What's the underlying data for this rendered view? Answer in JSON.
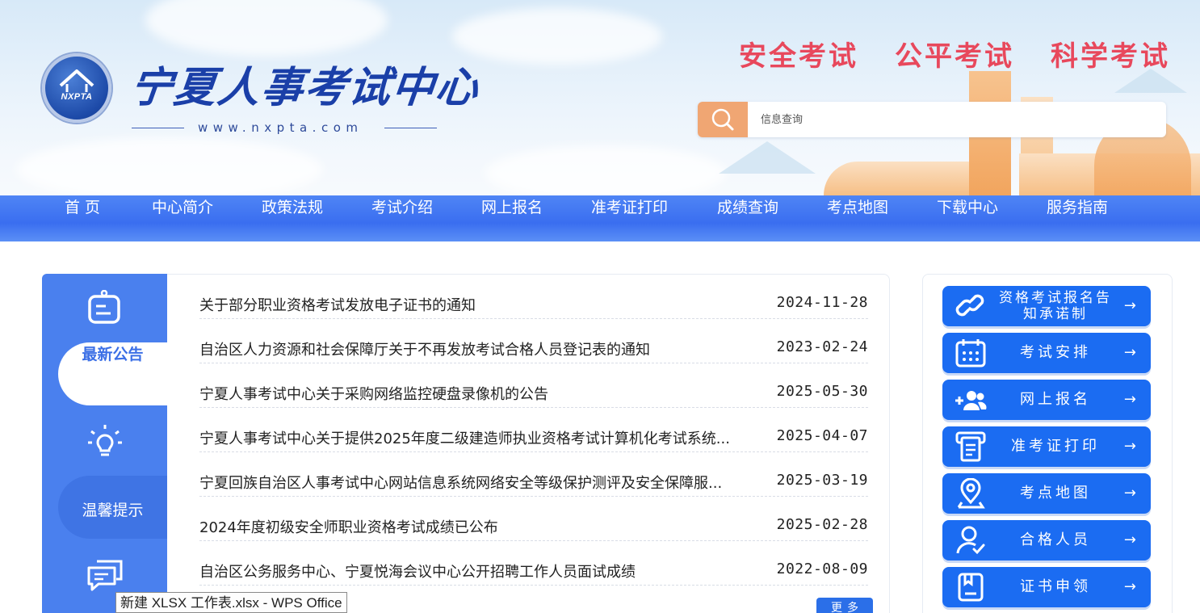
{
  "header": {
    "logo_text": "NXPTA",
    "site_title": "宁夏人事考试中心",
    "site_url": "www.nxpta.com",
    "slogans": [
      "安全考试",
      "公平考试",
      "科学考试"
    ],
    "search": {
      "placeholder": "信息查询",
      "icon": "search-icon"
    }
  },
  "nav": {
    "items": [
      "首  页",
      "中心简介",
      "政策法规",
      "考试介绍",
      "网上报名",
      "准考证打印",
      "成绩查询",
      "考点地图",
      "下载中心",
      "服务指南"
    ]
  },
  "notice_tabs": {
    "active": "最新公告",
    "tip": "温馨提示",
    "icons": [
      "notice-board-icon",
      "lightbulb-icon",
      "chat-icon"
    ]
  },
  "news": {
    "items": [
      {
        "title": "关于部分职业资格考试发放电子证书的通知",
        "date": "2024-11-28"
      },
      {
        "title": "自治区人力资源和社会保障厅关于不再发放考试合格人员登记表的通知",
        "date": "2023-02-24"
      },
      {
        "title": "宁夏人事考试中心关于采购网络监控硬盘录像机的公告",
        "date": "2025-05-30"
      },
      {
        "title": "宁夏人事考试中心关于提供2025年度二级建造师执业资格考试计算机化考试系统...",
        "date": "2025-04-07"
      },
      {
        "title": "宁夏回族自治区人事考试中心网站信息系统网络安全等级保护测评及安全保障服...",
        "date": "2025-03-19"
      },
      {
        "title": "2024年度初级安全师职业资格考试成绩已公布",
        "date": "2025-02-28"
      },
      {
        "title": "自治区公务服务中心、宁夏悦海会议中心公开招聘工作人员面试成绩",
        "date": "2022-08-09"
      }
    ],
    "more_label": "更多"
  },
  "quick_links": [
    {
      "label": "资格考试报名告知承诺制",
      "icon": "link-icon"
    },
    {
      "label": "考试安排",
      "icon": "calendar-icon"
    },
    {
      "label": "网上报名",
      "icon": "add-user-icon"
    },
    {
      "label": "准考证打印",
      "icon": "print-icon"
    },
    {
      "label": "考点地图",
      "icon": "map-pin-icon"
    },
    {
      "label": "合格人员",
      "icon": "user-check-icon"
    },
    {
      "label": "证书申领",
      "icon": "certificate-icon"
    }
  ],
  "arrow_glyph": "→",
  "taskbar_tooltip": "新建 XLSX 工作表.xlsx - WPS Office",
  "colors": {
    "nav_blue": "#3a6ef0",
    "button_blue": "#1b6cf2",
    "slogan_red": "#e8485c",
    "search_orange": "#f0a673"
  }
}
